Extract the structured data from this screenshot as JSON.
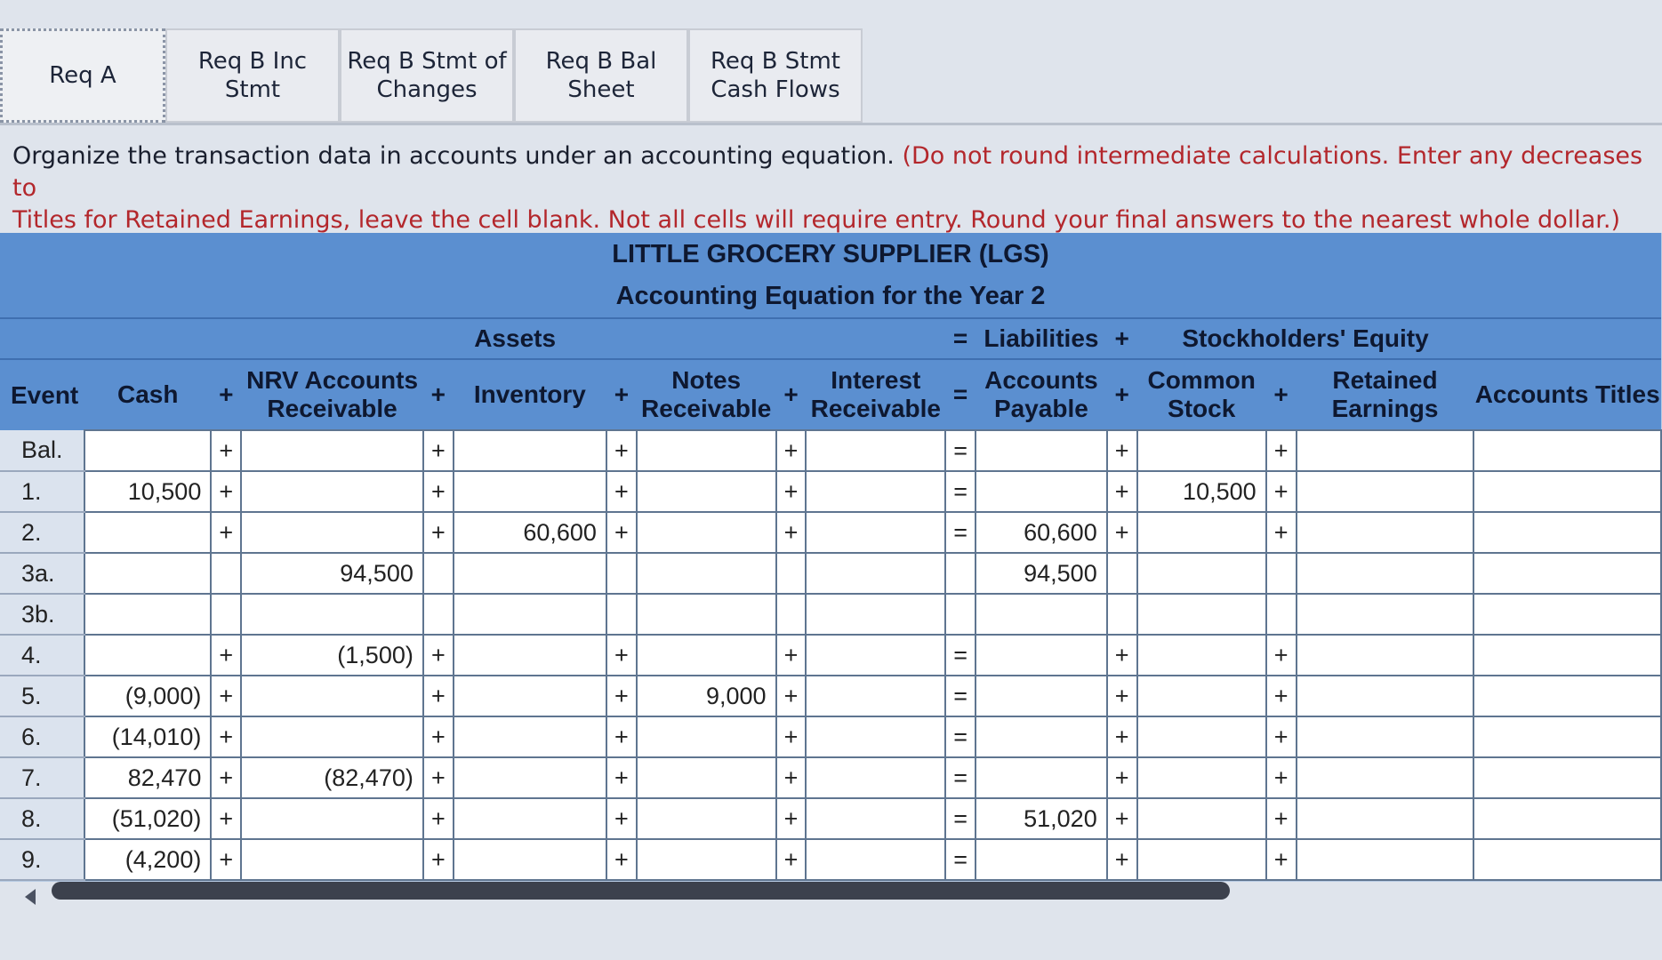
{
  "tabs": [
    {
      "label": "Req A",
      "active": true
    },
    {
      "label": "Req B Inc\nStmt",
      "active": false
    },
    {
      "label": "Req B Stmt of\nChanges",
      "active": false
    },
    {
      "label": "Req B Bal\nSheet",
      "active": false
    },
    {
      "label": "Req B Stmt\nCash Flows",
      "active": false
    }
  ],
  "instructions": {
    "main": "Organize the transaction data in accounts under an accounting equation.",
    "note": "(Do not round intermediate calculations. Enter any decreases to",
    "note_line2": "Titles for Retained Earnings, leave the cell blank. Not all cells will require entry. Round your final answers to the nearest whole dollar.)"
  },
  "table": {
    "company": "LITTLE GROCERY SUPPLIER (LGS)",
    "subtitle": "Accounting Equation for the Year 2",
    "groups": {
      "assets": "Assets",
      "eq": "=",
      "liabilities": "Liabilities",
      "plus": "+",
      "equity": "Stockholders' Equity"
    },
    "columns": {
      "event": "Event",
      "cash": "Cash",
      "nrv": "NRV Accounts Receivable",
      "inventory": "Inventory",
      "notes": "Notes Receivable",
      "interest": "Interest Receivable",
      "payable": "Accounts Payable",
      "common": "Common Stock",
      "retained": "Retained Earnings",
      "titles": "Accounts Titles"
    },
    "signs": {
      "plus": "+",
      "eq": "="
    },
    "rows": [
      {
        "event": "Bal.",
        "cash": "",
        "nrv": "",
        "inventory": "",
        "notes": "",
        "interest": "",
        "payable": "",
        "common": "",
        "retained": "",
        "signs": true
      },
      {
        "event": "1.",
        "cash": "10,500",
        "nrv": "",
        "inventory": "",
        "notes": "",
        "interest": "",
        "payable": "",
        "common": "10,500",
        "retained": "",
        "signs": true
      },
      {
        "event": "2.",
        "cash": "",
        "nrv": "",
        "inventory": "60,600",
        "notes": "",
        "interest": "",
        "payable": "60,600",
        "common": "",
        "retained": "",
        "signs": true
      },
      {
        "event": "3a.",
        "cash": "",
        "nrv": "94,500",
        "inventory": "",
        "notes": "",
        "interest": "",
        "payable": "94,500",
        "common": "",
        "retained": "",
        "signs": false
      },
      {
        "event": "3b.",
        "cash": "",
        "nrv": "",
        "inventory": "",
        "notes": "",
        "interest": "",
        "payable": "",
        "common": "",
        "retained": "",
        "signs": false
      },
      {
        "event": "4.",
        "cash": "",
        "nrv": "(1,500)",
        "inventory": "",
        "notes": "",
        "interest": "",
        "payable": "",
        "common": "",
        "retained": "",
        "signs": true
      },
      {
        "event": "5.",
        "cash": "(9,000)",
        "nrv": "",
        "inventory": "",
        "notes": "9,000",
        "interest": "",
        "payable": "",
        "common": "",
        "retained": "",
        "signs": true
      },
      {
        "event": "6.",
        "cash": "(14,010)",
        "nrv": "",
        "inventory": "",
        "notes": "",
        "interest": "",
        "payable": "",
        "common": "",
        "retained": "",
        "signs": true
      },
      {
        "event": "7.",
        "cash": "82,470",
        "nrv": "(82,470)",
        "inventory": "",
        "notes": "",
        "interest": "",
        "payable": "",
        "common": "",
        "retained": "",
        "signs": true
      },
      {
        "event": "8.",
        "cash": "(51,020)",
        "nrv": "",
        "inventory": "",
        "notes": "",
        "interest": "",
        "payable": "51,020",
        "common": "",
        "retained": "",
        "signs": true
      },
      {
        "event": "9.",
        "cash": "(4,200)",
        "nrv": "",
        "inventory": "",
        "notes": "",
        "interest": "",
        "payable": "",
        "common": "",
        "retained": "",
        "signs": true
      }
    ]
  },
  "colors": {
    "header_blue": "#5b8fd0",
    "instruction_red": "#b3272c"
  }
}
